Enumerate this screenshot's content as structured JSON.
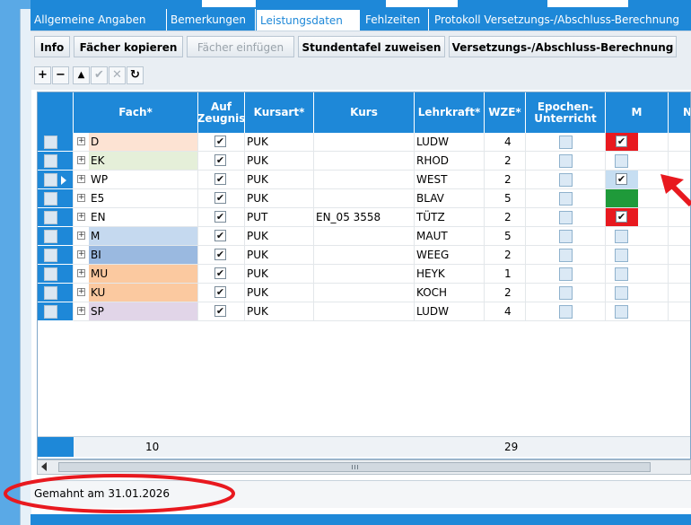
{
  "tabs": [
    {
      "label": "Allgemeine Angaben",
      "active": false
    },
    {
      "label": "Bemerkungen",
      "active": false
    },
    {
      "label": "Leistungsdaten",
      "active": true
    },
    {
      "label": "Fehlzeiten",
      "active": false
    },
    {
      "label": "Protokoll Versetzungs-/Abschluss-Berechnung",
      "active": false
    }
  ],
  "toolbar": {
    "info": "Info",
    "copy": "Fächer kopieren",
    "paste": "Fächer einfügen",
    "assign": "Stundentafel zuweisen",
    "calc": "Versetzungs-/Abschluss-Berechnung"
  },
  "tools": {
    "add": "+",
    "remove": "−",
    "up": "▲",
    "ok": "✔",
    "cancel": "✕",
    "refresh": "↻"
  },
  "columns": {
    "fach": "Fach*",
    "zeugnis": "Auf Zeugnis",
    "kursart": "Kursart*",
    "kurs": "Kurs",
    "lehrkraft": "Lehrkraft*",
    "wze": "WZE*",
    "epochen": "Epochen-Unterricht",
    "m": "M",
    "next": "N"
  },
  "rows": [
    {
      "fach": "D",
      "color": "#fde3d3",
      "zeugnis": true,
      "kursart": "PUK",
      "kurs": "",
      "lehrkraft": "LUDW",
      "wze": "4",
      "m": "checked-red"
    },
    {
      "fach": "EK",
      "color": "#e5efd9",
      "zeugnis": true,
      "kursart": "PUK",
      "kurs": "",
      "lehrkraft": "RHOD",
      "wze": "2",
      "m": "empty"
    },
    {
      "fach": "WP",
      "color": "#ffffff",
      "zeugnis": true,
      "kursart": "PUK",
      "kurs": "",
      "lehrkraft": "WEST",
      "wze": "2",
      "m": "checked-blue",
      "current": true
    },
    {
      "fach": "E5",
      "color": "#ffffff",
      "zeugnis": true,
      "kursart": "PUK",
      "kurs": "",
      "lehrkraft": "BLAV",
      "wze": "5",
      "m": "green"
    },
    {
      "fach": "EN",
      "color": "#ffffff",
      "zeugnis": true,
      "kursart": "PUT",
      "kurs": "EN_05 3558",
      "lehrkraft": "TÜTZ",
      "wze": "2",
      "m": "checked-red"
    },
    {
      "fach": "M",
      "color": "#c5d9ef",
      "zeugnis": true,
      "kursart": "PUK",
      "kurs": "",
      "lehrkraft": "MAUT",
      "wze": "5",
      "m": "empty"
    },
    {
      "fach": "BI",
      "color": "#9ab9e0",
      "zeugnis": true,
      "kursart": "PUK",
      "kurs": "",
      "lehrkraft": "WEEG",
      "wze": "2",
      "m": "empty"
    },
    {
      "fach": "MU",
      "color": "#fbc9a0",
      "zeugnis": true,
      "kursart": "PUK",
      "kurs": "",
      "lehrkraft": "HEYK",
      "wze": "1",
      "m": "empty"
    },
    {
      "fach": "KU",
      "color": "#fbc9a0",
      "zeugnis": true,
      "kursart": "PUK",
      "kurs": "",
      "lehrkraft": "KOCH",
      "wze": "2",
      "m": "empty"
    },
    {
      "fach": "SP",
      "color": "#e1d5e8",
      "zeugnis": true,
      "kursart": "PUK",
      "kurs": "",
      "lehrkraft": "LUDW",
      "wze": "4",
      "m": "empty"
    }
  ],
  "footer": {
    "count": "10",
    "wze_sum": "29"
  },
  "status": {
    "text": "Gemahnt am 31.01.2026"
  },
  "colors": {
    "accent": "#1e88d8",
    "red": "#e8191f",
    "green": "#1f9a3a",
    "annotation": "#e8191f"
  }
}
